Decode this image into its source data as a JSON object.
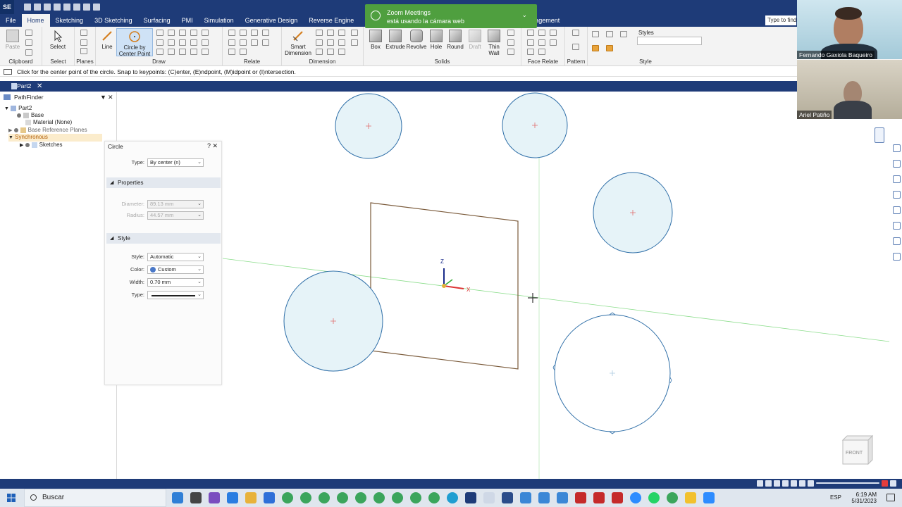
{
  "app": {
    "logo": "SE",
    "ribbon_tabs": [
      "File",
      "Home",
      "Sketching",
      "3D Sketching",
      "Surfacing",
      "PMI",
      "Simulation",
      "Generative Design",
      "Reverse Engine",
      "nagement"
    ],
    "active_tab": "Home",
    "search_placeholder": "Type to find"
  },
  "ribbon": {
    "groups": {
      "clipboard": "Clipboard",
      "select": "Select",
      "planes": "Planes",
      "draw": "Draw",
      "relate": "Relate",
      "dimension": "Dimension",
      "solids": "Solids",
      "face_relate": "Face Relate",
      "pattern": "Pattern",
      "style": "Style"
    },
    "buttons": {
      "paste": "Paste",
      "select": "Select",
      "line": "Line",
      "circle_line1": "Circle by",
      "circle_line2": "Center Point",
      "smart_dim_line1": "Smart",
      "smart_dim_line2": "Dimension",
      "box": "Box",
      "extrude": "Extrude",
      "revolve": "Revolve",
      "hole": "Hole",
      "round": "Round",
      "draft": "Draft",
      "thin_wall_line1": "Thin",
      "thin_wall_line2": "Wall",
      "styles": "Styles"
    }
  },
  "prompt": "Click for the center point of the circle.  Snap to keypoints: (C)enter, (E)ndpoint, (M)idpoint or (I)ntersection.",
  "document_tab": "Part2",
  "pathfinder": {
    "title": "PathFinder",
    "items": [
      {
        "label": "Part2"
      },
      {
        "label": "Base"
      },
      {
        "label": "Material (None)"
      },
      {
        "label": "Base Reference Planes"
      },
      {
        "label": "Synchronous"
      },
      {
        "label": "Sketches"
      }
    ]
  },
  "circle_panel": {
    "title": "Circle",
    "help": "?",
    "close": "✕",
    "type_label": "Type:",
    "type_value": "By center (n)",
    "properties_section": "Properties",
    "diameter_label": "Diameter:",
    "diameter_value": "89.13 mm",
    "radius_label": "Radius:",
    "radius_value": "44.57 mm",
    "style_section": "Style",
    "style_label": "Style:",
    "style_value": "Automatic",
    "color_label": "Color:",
    "color_value": "Custom",
    "width_label": "Width:",
    "width_value": "0.70 mm",
    "linetype_label": "Type:"
  },
  "canvas": {
    "axis_z": "Z",
    "axis_x": "X",
    "view_cube": "FRONT"
  },
  "zoom_notification": {
    "title": "Zoom Meetings",
    "message": "está usando la cámara web"
  },
  "video_tiles": [
    {
      "name": "Fernando Gaxiola Baqueiro"
    },
    {
      "name": "Ariel Patiño"
    }
  ],
  "taskbar": {
    "search": "Buscar",
    "lang": "ESP",
    "time": "6:19 AM",
    "date": "5/31/2023"
  },
  "colors": {
    "accent": "#1e3b78",
    "sketch_circle": "#2f6fa8",
    "circle_fill": "#e6f3f8",
    "profile": "#7a5a3a",
    "axis_line": "#7fd87f",
    "notification": "#4f9f3f"
  }
}
